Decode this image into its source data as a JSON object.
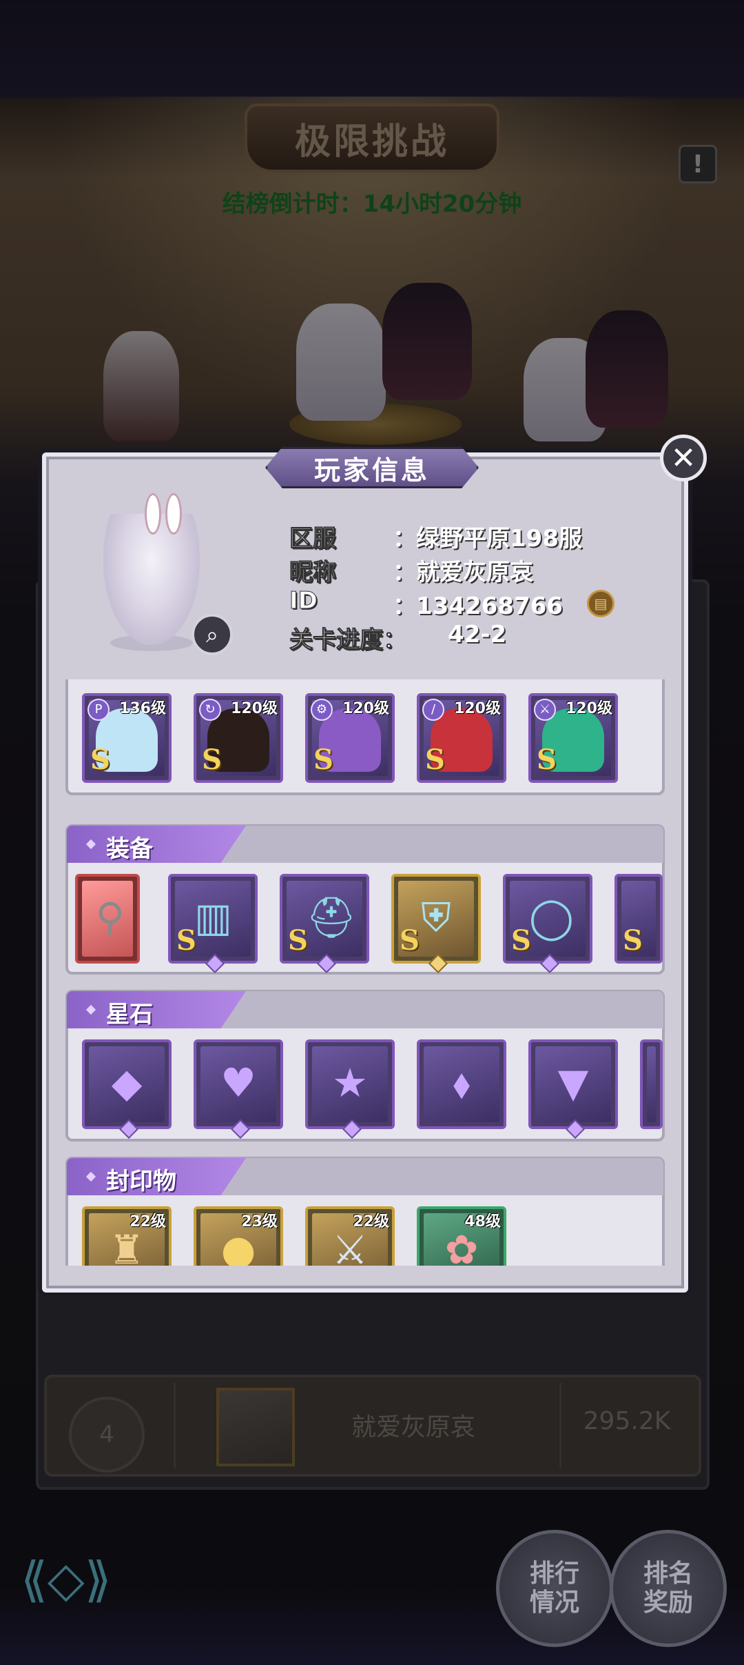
{
  "background": {
    "title": "极限挑战",
    "countdown": "结榜倒计时：14小时20分钟",
    "info_button": "!",
    "ranking_row": {
      "rank": "4",
      "name": "就爱灰原哀",
      "score": "295.2K"
    },
    "buttons": {
      "ranking_status": "排行情况",
      "ranking_rewards": "排名奖励"
    }
  },
  "modal": {
    "title": "玩家信息",
    "close_icon": "close-icon",
    "player": {
      "server_label": "区服",
      "server_value": "：绿野平原198服",
      "nickname_label": "昵称",
      "nickname_value": "：就爱灰原哀",
      "id_label": "ID",
      "id_value": "：134268766",
      "stage_label": "关卡进度：",
      "stage_value": "42-2"
    },
    "heroes": [
      {
        "level": "136级",
        "grade": "S",
        "hair": "#bfe4f5"
      },
      {
        "level": "120级",
        "grade": "S",
        "hair": "#2b1d1a"
      },
      {
        "level": "120级",
        "grade": "S",
        "hair": "#8a5bc4"
      },
      {
        "level": "120级",
        "grade": "S",
        "hair": "#c8323a"
      },
      {
        "level": "120级",
        "grade": "S",
        "hair": "#2fb38a"
      }
    ],
    "equipment": {
      "title": "装备",
      "items": [
        {
          "icon": "wand-icon",
          "grade": ""
        },
        {
          "icon": "book-icon",
          "grade": "S"
        },
        {
          "icon": "helmet-icon",
          "grade": "S"
        },
        {
          "icon": "armor-icon",
          "grade": "S"
        },
        {
          "icon": "ring-icon",
          "grade": "S"
        },
        {
          "icon": "boots-icon",
          "grade": "S"
        }
      ]
    },
    "star_stones": {
      "title": "星石",
      "items": [
        {
          "icon": "square-gem-icon",
          "glyph": "◆"
        },
        {
          "icon": "heart-gem-icon",
          "glyph": "♥"
        },
        {
          "icon": "star-gem-icon",
          "glyph": "★"
        },
        {
          "icon": "crystal-gem-icon",
          "glyph": "⬧"
        },
        {
          "icon": "triangle-gem-icon",
          "glyph": "▼"
        }
      ]
    },
    "seals": {
      "title": "封印物",
      "items": [
        {
          "icon": "bell-icon",
          "level": "22级"
        },
        {
          "icon": "coin-icon",
          "level": "23级"
        },
        {
          "icon": "swords-icon",
          "level": "22级"
        },
        {
          "icon": "flower-icon",
          "level": "48级"
        }
      ]
    }
  }
}
